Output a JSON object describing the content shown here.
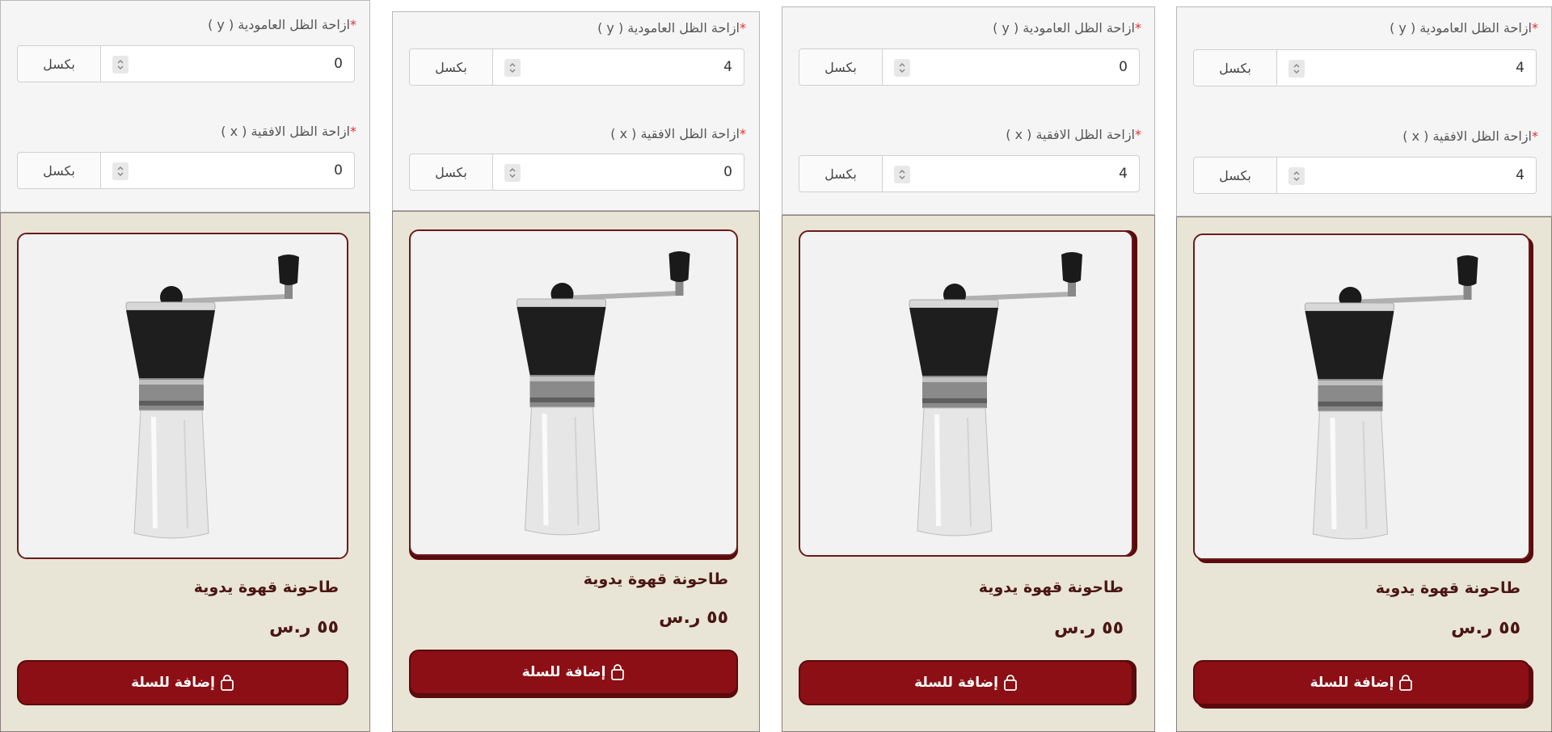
{
  "labels": {
    "shadow_y": "ازاحة الظل العامودية ( y )",
    "shadow_x": "ازاحة الظل الافقية ( x )",
    "required_mark": "*",
    "unit": "بكسل"
  },
  "product": {
    "title": "طاحونة قهوة يدوية",
    "price": "٥٥ ر.س",
    "add_to_cart": "إضافة للسلة"
  },
  "variants": [
    {
      "shadow_y": "0",
      "shadow_x": "0"
    },
    {
      "shadow_y": "4",
      "shadow_x": "0"
    },
    {
      "shadow_y": "0",
      "shadow_x": "4"
    },
    {
      "shadow_y": "4",
      "shadow_x": "4"
    }
  ],
  "icons": {
    "spinner": "spinner-icon",
    "cart": "shopping-bag-icon"
  },
  "colors": {
    "card_background": "#e9e5d6",
    "brand": "#8b0f14",
    "border": "#6b1b1b",
    "text": "#4a1616",
    "required": "#e03131"
  }
}
